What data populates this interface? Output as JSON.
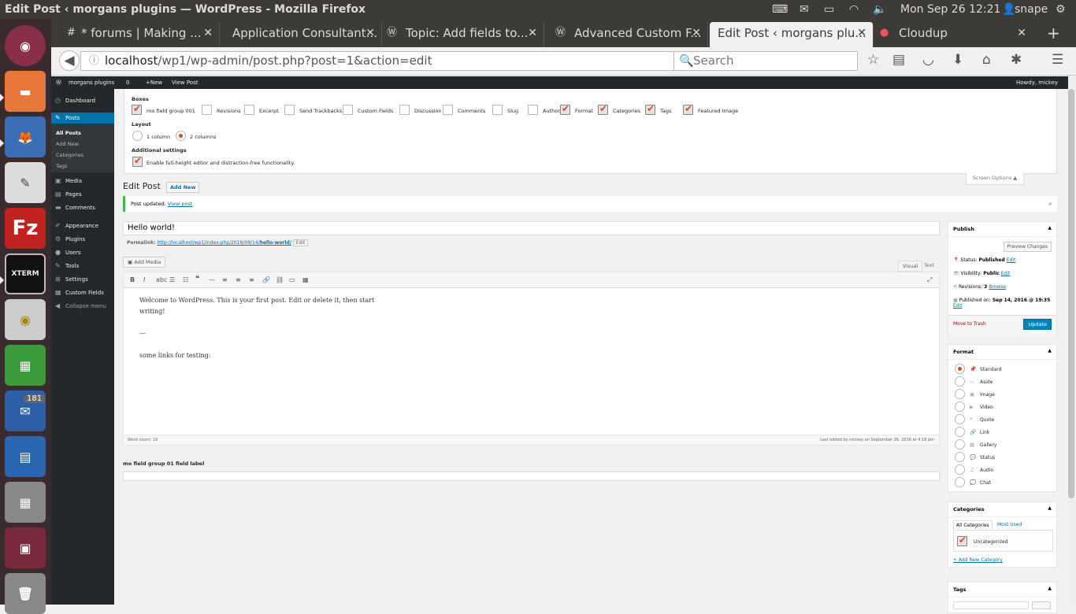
{
  "os": {
    "window_title": "Edit Post ‹ morgans plugins — WordPress - Mozilla Firefox",
    "clock": "Mon Sep 26 12:21",
    "user": "snape",
    "launcher_badge": "181",
    "launcher_icons": [
      "ubuntu-dash-icon",
      "files-icon",
      "firefox-icon",
      "text-editor-icon",
      "filezilla-icon",
      "xterm-icon",
      "speaker-icon",
      "spreadsheet-icon",
      "thunderbird-icon",
      "writer-icon",
      "calculator-icon",
      "workspace-icon",
      "trash-icon"
    ]
  },
  "browser": {
    "tabs": [
      {
        "label": "* forums | Making ...",
        "icon": "#"
      },
      {
        "label": "Application Consultant...",
        "icon": ""
      },
      {
        "label": "Topic: Add fields to...",
        "icon": "W"
      },
      {
        "label": "Advanced Custom F...",
        "icon": "W"
      },
      {
        "label": "Edit Post ‹ morgans plu...",
        "icon": "",
        "active": true
      },
      {
        "label": "Cloudup",
        "icon": "C"
      }
    ],
    "url": "localhost/wp1/wp-admin/post.php?post=1&action=edit",
    "url_host": "localhost",
    "url_path": "/wp1/wp-admin/post.php?post=1&action=edit",
    "search_placeholder": "Search"
  },
  "adminbar": {
    "site": "morgans plugins",
    "comments": "0",
    "new": "New",
    "view": "View Post",
    "howdy": "Howdy, mickey"
  },
  "menu": {
    "items": [
      {
        "label": "Dashboard",
        "icon": "◷"
      },
      {
        "label": "Posts",
        "icon": "✎",
        "current": true
      },
      {
        "label": "Media",
        "icon": "▣"
      },
      {
        "label": "Pages",
        "icon": "▤"
      },
      {
        "label": "Comments",
        "icon": "▬"
      },
      {
        "label": "Appearance",
        "icon": "✐"
      },
      {
        "label": "Plugins",
        "icon": "⚙"
      },
      {
        "label": "Users",
        "icon": "●"
      },
      {
        "label": "Tools",
        "icon": "✎"
      },
      {
        "label": "Settings",
        "icon": "⊞"
      },
      {
        "label": "Custom Fields",
        "icon": "▦"
      },
      {
        "label": "Collapse menu",
        "icon": "◀"
      }
    ],
    "posts_sub": [
      "All Posts",
      "Add New",
      "Categories",
      "Tags"
    ]
  },
  "screen_options": {
    "boxes_heading": "Boxes",
    "boxes": [
      {
        "label": "mo field group 001",
        "checked": true
      },
      {
        "label": "Revisions",
        "checked": false
      },
      {
        "label": "Excerpt",
        "checked": false
      },
      {
        "label": "Send Trackbacks",
        "checked": false
      },
      {
        "label": "Custom Fields",
        "checked": false
      },
      {
        "label": "Discussion",
        "checked": false
      },
      {
        "label": "Comments",
        "checked": false
      },
      {
        "label": "Slug",
        "checked": false
      },
      {
        "label": "Author",
        "checked": false
      },
      {
        "label": "Format",
        "checked": true
      },
      {
        "label": "Categories",
        "checked": true
      },
      {
        "label": "Tags",
        "checked": true
      },
      {
        "label": "Featured Image",
        "checked": true
      }
    ],
    "layout_heading": "Layout",
    "layout": [
      {
        "label": "1 column",
        "checked": false
      },
      {
        "label": "2 columns",
        "checked": true
      }
    ],
    "additional_heading": "Additional settings",
    "additional": {
      "label": "Enable full-height editor and distraction-free functionality.",
      "checked": true
    },
    "toggle": "Screen Options ▲"
  },
  "page": {
    "title": "Edit Post",
    "add_new": "Add New",
    "notice": "Post updated.",
    "notice_link": "View post"
  },
  "post": {
    "title": "Hello world!",
    "permalink_label": "Permalink:",
    "permalink_url": "http://localhost/wp1/index.php/2016/09/14/",
    "permalink_slug": "hello-world/",
    "edit": "Edit",
    "add_media": "Add Media",
    "tab_visual": "Visual",
    "tab_text": "Text",
    "body": [
      "Welcome to WordPress. This is your first post. Edit or delete it, then start",
      "writing!",
      "",
      "---",
      "",
      "some links for testing:"
    ],
    "word_count": "Word count: 19",
    "last_edited": "Last edited by mickey on September 26, 2016 at 4:18 pm"
  },
  "acf": {
    "label": "mo field group 01 field label",
    "value": ""
  },
  "publish": {
    "title": "Publish",
    "preview": "Preview Changes",
    "status_label": "Status:",
    "status": "Published",
    "visibility_label": "Visibility:",
    "visibility": "Public",
    "revisions_label": "Revisions:",
    "revisions": "3",
    "browse": "Browse",
    "published_label": "Published on:",
    "published": "Sep 14, 2016 @ 19:35",
    "edit": "Edit",
    "trash": "Move to Trash",
    "update": "Update"
  },
  "format": {
    "title": "Format",
    "options": [
      {
        "label": "Standard",
        "checked": true
      },
      {
        "label": "Aside"
      },
      {
        "label": "Image"
      },
      {
        "label": "Video"
      },
      {
        "label": "Quote"
      },
      {
        "label": "Link"
      },
      {
        "label": "Gallery"
      },
      {
        "label": "Status"
      },
      {
        "label": "Audio"
      },
      {
        "label": "Chat"
      }
    ]
  },
  "categories": {
    "title": "Categories",
    "tab_all": "All Categories",
    "tab_used": "Most Used",
    "items": [
      {
        "label": "Uncategorized",
        "checked": true
      }
    ],
    "add": "+ Add New Category"
  },
  "tags": {
    "title": "Tags"
  },
  "colors": {
    "accent": "#0073aa",
    "checkmark": "#d54e21",
    "menu_bg": "#23282d"
  }
}
